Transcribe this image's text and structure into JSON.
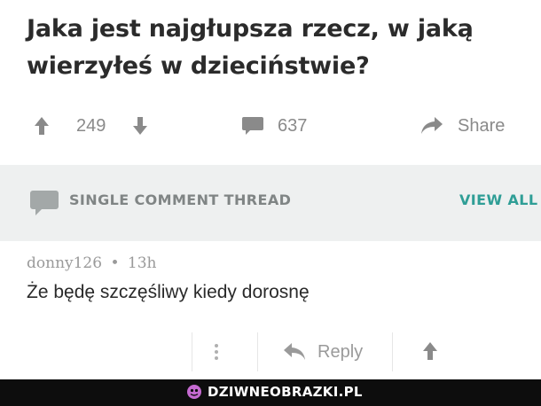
{
  "post": {
    "title_line1": "Jaka jest najgłupsza rzecz, w jaką",
    "title_line2": "wierzyłeś w dzieciństwie?",
    "upvotes": "249",
    "comments": "637",
    "share_label": "Share"
  },
  "thread": {
    "label": "SINGLE COMMENT THREAD",
    "view_all": "VIEW ALL"
  },
  "comment": {
    "author": "donny126",
    "separator": "•",
    "age": "13h",
    "text": "Że będę szczęśliwy kiedy dorosnę",
    "reply_label": "Reply"
  },
  "footer": {
    "brand": "DZIWNEOBRAZKI.PL"
  },
  "colors": {
    "text": "#2b2b2b",
    "muted": "#8a8a8a",
    "accent": "#2f9e96",
    "thread_bg": "#eef0f0",
    "footer_bg": "#0d0d0d"
  },
  "icons": [
    "upvote-icon",
    "downvote-icon",
    "comment-icon",
    "share-icon",
    "chat-bubble-icon",
    "more-icon",
    "reply-icon",
    "brand-logo-icon"
  ]
}
